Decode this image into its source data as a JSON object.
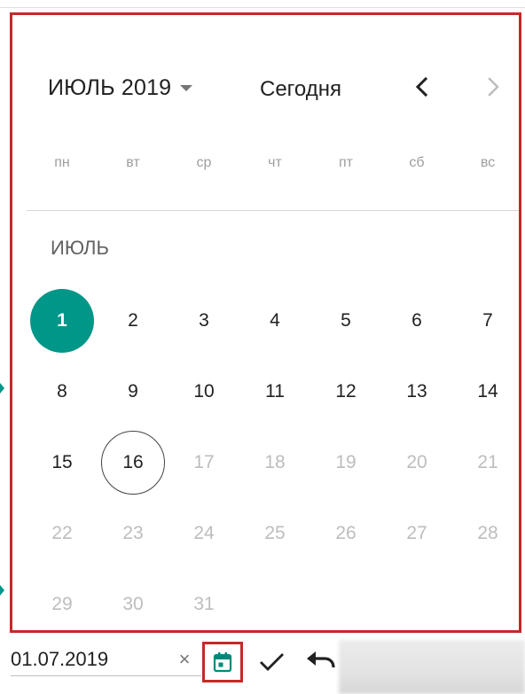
{
  "calendar": {
    "month_select_label": "ИЮЛЬ 2019",
    "today_label": "Сегодня",
    "weekdays": [
      "пн",
      "вт",
      "ср",
      "чт",
      "пт",
      "сб",
      "вс"
    ],
    "month_heading": "ИЮЛЬ",
    "days": [
      {
        "label": "1",
        "state": "selected"
      },
      {
        "label": "2",
        "state": "normal"
      },
      {
        "label": "3",
        "state": "normal"
      },
      {
        "label": "4",
        "state": "normal"
      },
      {
        "label": "5",
        "state": "normal"
      },
      {
        "label": "6",
        "state": "normal"
      },
      {
        "label": "7",
        "state": "normal"
      },
      {
        "label": "8",
        "state": "normal"
      },
      {
        "label": "9",
        "state": "normal"
      },
      {
        "label": "10",
        "state": "normal"
      },
      {
        "label": "11",
        "state": "normal"
      },
      {
        "label": "12",
        "state": "normal"
      },
      {
        "label": "13",
        "state": "normal"
      },
      {
        "label": "14",
        "state": "normal"
      },
      {
        "label": "15",
        "state": "normal"
      },
      {
        "label": "16",
        "state": "today"
      },
      {
        "label": "17",
        "state": "disabled"
      },
      {
        "label": "18",
        "state": "disabled"
      },
      {
        "label": "19",
        "state": "disabled"
      },
      {
        "label": "20",
        "state": "disabled"
      },
      {
        "label": "21",
        "state": "disabled"
      },
      {
        "label": "22",
        "state": "disabled"
      },
      {
        "label": "23",
        "state": "disabled"
      },
      {
        "label": "24",
        "state": "disabled"
      },
      {
        "label": "25",
        "state": "disabled"
      },
      {
        "label": "26",
        "state": "disabled"
      },
      {
        "label": "27",
        "state": "disabled"
      },
      {
        "label": "28",
        "state": "disabled"
      },
      {
        "label": "29",
        "state": "disabled"
      },
      {
        "label": "30",
        "state": "disabled"
      },
      {
        "label": "31",
        "state": "disabled"
      }
    ]
  },
  "date_field": {
    "value": "01.07.2019",
    "clear_icon": "close-icon",
    "calendar_icon": "calendar-icon",
    "confirm_icon": "check-icon",
    "undo_icon": "undo-icon"
  },
  "colors": {
    "accent": "#009688",
    "highlight_border": "#c62828",
    "disabled_text": "#bdbdbd"
  }
}
